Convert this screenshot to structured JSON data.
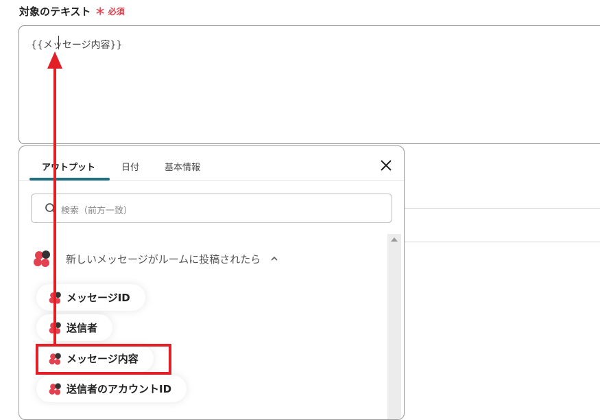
{
  "field": {
    "label": "対象のテキスト",
    "required_mark": "＊",
    "required_text": "必須",
    "value": "{{メッセージ内容}}"
  },
  "popup": {
    "tabs": [
      {
        "label": "アウトプット",
        "active": true
      },
      {
        "label": "日付",
        "active": false
      },
      {
        "label": "基本情報",
        "active": false
      }
    ],
    "search_placeholder": "検索（前方一致）",
    "group": {
      "title": "新しいメッセージがルームに投稿されたら",
      "expanded": true
    },
    "items": [
      {
        "label": "メッセージID"
      },
      {
        "label": "送信者"
      },
      {
        "label": "メッセージ内容",
        "highlighted": true
      },
      {
        "label": "送信者のアカウントID"
      }
    ]
  },
  "colors": {
    "accent": "#1f6f80",
    "required": "#e2424f",
    "annotation": "#e21f26",
    "logo_red": "#e2424f",
    "logo_dark": "#333333"
  },
  "icons": {
    "search": "search-icon",
    "close": "close-icon",
    "chevron": "chevron-up-icon",
    "app_logo": "chatwork-logo-icon"
  }
}
